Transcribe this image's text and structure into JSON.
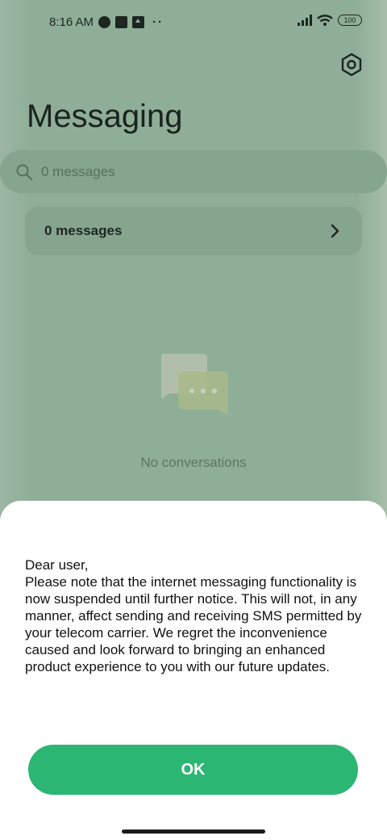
{
  "status_bar": {
    "time": "8:16 AM",
    "battery": "100"
  },
  "header": {
    "title": "Messaging",
    "settings_icon": "settings-hex-icon"
  },
  "search": {
    "placeholder": "0 messages"
  },
  "summary_card": {
    "label": "0 messages"
  },
  "empty_state": {
    "text": "No conversations"
  },
  "dialog": {
    "greeting": "Dear user,",
    "message": "Please note that the internet messaging functionality is now suspended until further notice. This will not, in any manner, affect sending and receiving SMS permitted by your telecom carrier. We regret the inconvenience caused and look forward to bringing an enhanced product experience to you with our future updates.",
    "ok_label": "OK"
  },
  "colors": {
    "accent": "#2cb673",
    "background_tint": "#8fae98"
  }
}
